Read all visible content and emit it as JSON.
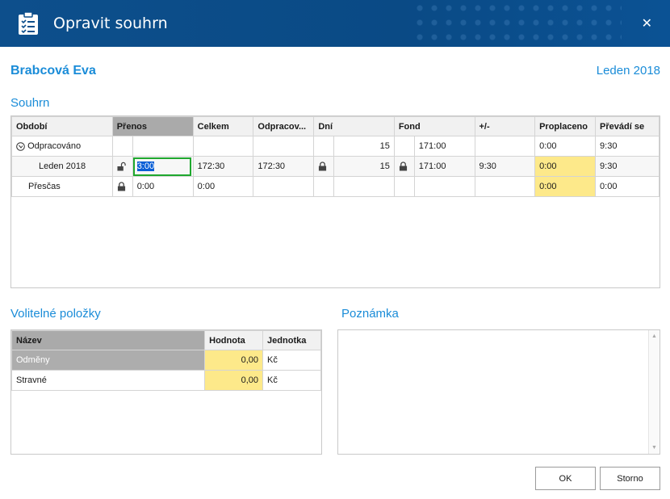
{
  "window": {
    "title": "Opravit souhrn",
    "close_label": "✕"
  },
  "employee": {
    "name": "Brabcová Eva",
    "period": "Leden 2018"
  },
  "summary": {
    "section_title": "Souhrn",
    "columns": [
      "Období",
      "Přenos",
      "Celkem",
      "Odpracov...",
      "Dní",
      "Fond",
      "+/-",
      "Proplaceno",
      "Převádí se"
    ],
    "rows": [
      {
        "label": "Odpracováno",
        "prenos": "",
        "celkem": "",
        "odpracovano": "",
        "dni": "15",
        "fond": "171:00",
        "diff": "",
        "proplaceno": "0:00",
        "prevadi": "9:30"
      },
      {
        "label": "Leden 2018",
        "prenos": "3:00",
        "celkem": "172:30",
        "odpracovano": "172:30",
        "dni": "15",
        "fond": "171:00",
        "diff": "9:30",
        "proplaceno": "0:00",
        "prevadi": "9:30"
      },
      {
        "label": "Přesčas",
        "prenos": "0:00",
        "celkem": "0:00",
        "odpracovano": "",
        "dni": "",
        "fond": "",
        "diff": "",
        "proplaceno": "0:00",
        "prevadi": "0:00"
      }
    ]
  },
  "optional": {
    "section_title": "Volitelné položky",
    "columns": [
      "Název",
      "Hodnota",
      "Jednotka"
    ],
    "rows": [
      {
        "name": "Odměny",
        "value": "0,00",
        "unit": "Kč"
      },
      {
        "name": "Stravné",
        "value": "0,00",
        "unit": "Kč"
      }
    ]
  },
  "note": {
    "section_title": "Poznámka",
    "text": ""
  },
  "buttons": {
    "ok": "OK",
    "cancel": "Storno"
  },
  "colors": {
    "accent": "#1a8cd8",
    "titlebar": "#0d4f8c",
    "highlight_yellow": "#fde98a",
    "edit_border": "#1fa82e"
  }
}
